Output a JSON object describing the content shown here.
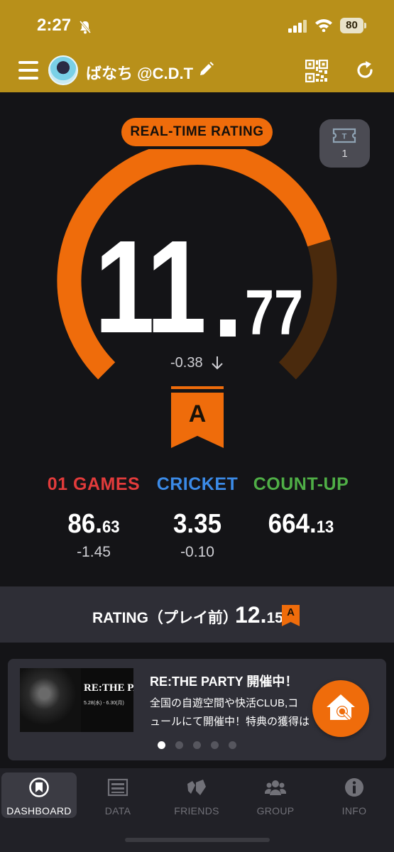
{
  "status": {
    "time": "2:27",
    "battery": "80"
  },
  "header": {
    "username": "ばなち @C.D.T",
    "icons": [
      "menu-icon",
      "avatar",
      "pencil-icon",
      "qr-code-icon",
      "refresh-icon"
    ]
  },
  "rating": {
    "badge_label": "REAL-TIME RATING",
    "ticket_count": "1",
    "integer": "11",
    "decimal": "77",
    "value": 11.77,
    "diff": "-0.38",
    "rank": "A",
    "gauge_fill_fraction": 0.77
  },
  "stats": [
    {
      "title": "01 GAMES",
      "int": "86.",
      "dec": "63",
      "diff": "-1.45",
      "color": "#e23b3b"
    },
    {
      "title": "CRICKET",
      "int": "3.35",
      "dec": "",
      "diff": "-0.10",
      "color": "#3b8ae6"
    },
    {
      "title": "COUNT-UP",
      "int": "664.",
      "dec": "13",
      "diff": "",
      "color": "#4fae46"
    }
  ],
  "pre_rating": {
    "label": "RATING（プレイ前）",
    "int": "12.",
    "dec": "15",
    "rank": "A"
  },
  "banner": {
    "image_title": "RE:THE PARTY",
    "image_date": "5.28(水) - 6.30(月)",
    "title": "RE:THE PARTY 開催中！",
    "line1": "全国の自遊空間や快活CLUB,コ",
    "line2": "ュールにて開催中！特典の獲得は",
    "active_dot": 0,
    "dot_count": 5
  },
  "tabs": [
    {
      "label": "DASHBOARD",
      "icon": "dashboard-icon"
    },
    {
      "label": "DATA",
      "icon": "data-icon"
    },
    {
      "label": "FRIENDS",
      "icon": "friends-icon"
    },
    {
      "label": "GROUP",
      "icon": "group-icon"
    },
    {
      "label": "INFO",
      "icon": "info-icon"
    }
  ],
  "colors": {
    "header": "#b8901a",
    "accent": "#ef6c0b",
    "background": "#141417"
  }
}
